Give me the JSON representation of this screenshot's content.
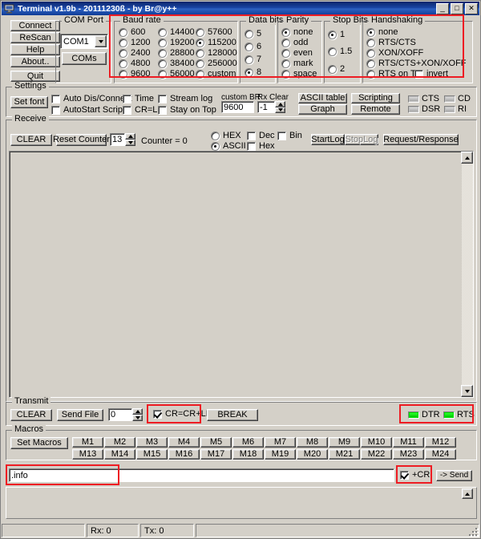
{
  "window": {
    "title": "Terminal v1.9b - 20111230ß - by Br@y++",
    "minimize": "_",
    "maximize": "□",
    "close": "✕",
    "app_icon": "terminal-icon"
  },
  "left_buttons": [
    {
      "label": "Connect",
      "name": "connect-button"
    },
    {
      "label": "ReScan",
      "name": "rescan-button"
    },
    {
      "label": "Help",
      "name": "help-button"
    },
    {
      "label": "About..",
      "name": "about-button"
    },
    {
      "label": "Quit",
      "name": "quit-button"
    }
  ],
  "com_port": {
    "legend": "COM Port",
    "selected": "COM1",
    "coms_label": "COMs"
  },
  "baud_rate": {
    "legend": "Baud rate",
    "selected": "115200",
    "col1": [
      "600",
      "1200",
      "2400",
      "4800",
      "9600"
    ],
    "col2": [
      "14400",
      "19200",
      "28800",
      "38400",
      "56000"
    ],
    "col3": [
      "57600",
      "115200",
      "128000",
      "256000",
      "custom"
    ]
  },
  "data_bits": {
    "legend": "Data bits",
    "selected": "8",
    "options": [
      "5",
      "6",
      "7",
      "8"
    ]
  },
  "parity": {
    "legend": "Parity",
    "selected": "none",
    "options": [
      "none",
      "odd",
      "even",
      "mark",
      "space"
    ]
  },
  "stop_bits": {
    "legend": "Stop Bits",
    "selected": "1",
    "options": [
      "1",
      "1.5",
      "2"
    ]
  },
  "handshaking": {
    "legend": "Handshaking",
    "selected": "none",
    "options": [
      "none",
      "RTS/CTS",
      "XON/XOFF",
      "RTS/CTS+XON/XOFF",
      "RTS on TX"
    ],
    "invert_label": "invert",
    "invert_checked": false
  },
  "settings": {
    "legend": "Settings",
    "set_font_label": "Set font",
    "checkboxes": [
      {
        "label": "Auto Dis/Connect",
        "checked": false,
        "name": "auto-disconnect-checkbox"
      },
      {
        "label": "AutoStart Script",
        "checked": false,
        "name": "autostart-script-checkbox"
      },
      {
        "label": "Time",
        "checked": false,
        "name": "time-checkbox"
      },
      {
        "label": "CR=LF",
        "checked": false,
        "name": "cr-equals-lf-checkbox"
      },
      {
        "label": "Stream log",
        "checked": false,
        "name": "stream-log-checkbox"
      },
      {
        "label": "Stay on Top",
        "checked": false,
        "name": "stay-on-top-checkbox"
      }
    ],
    "custom_br_label": "custom BR",
    "custom_br_value": "9600",
    "rx_clear_label": "Rx Clear",
    "rx_clear_value": "-1",
    "tool_buttons": [
      {
        "label": "ASCII table",
        "name": "ascii-table-button"
      },
      {
        "label": "Scripting",
        "name": "scripting-button"
      },
      {
        "label": "Graph",
        "name": "graph-button"
      },
      {
        "label": "Remote",
        "name": "remote-button"
      }
    ],
    "leds": [
      {
        "label": "CTS",
        "state": "dark"
      },
      {
        "label": "CD",
        "state": "dark"
      },
      {
        "label": "DSR",
        "state": "dark"
      },
      {
        "label": "RI",
        "state": "dark"
      }
    ]
  },
  "receive": {
    "legend": "Receive",
    "clear_label": "CLEAR",
    "reset_counter_label": "Reset Counter",
    "counter_input_value": "13",
    "counter_text": "Counter = 0",
    "format_options": [
      "HEX",
      "ASCII"
    ],
    "format_selected": "ASCII",
    "dec_label": "Dec",
    "dec_checked": false,
    "hex_label": "Hex",
    "hex_checked": false,
    "bin_label": "Bin",
    "bin_checked": false,
    "startlog_label": "StartLog",
    "stoplog_label": "StopLog",
    "stoplog_disabled": true,
    "request_response_label": "Request/Response",
    "text": ""
  },
  "transmit": {
    "legend": "Transmit",
    "clear_label": "CLEAR",
    "send_file_label": "Send File",
    "delay_value": "0",
    "cr_crlf_label": "CR=CR+LF",
    "cr_crlf_checked": true,
    "break_label": "BREAK",
    "dtr_label": "DTR",
    "dtr_on": true,
    "rts_label": "RTS",
    "rts_on": true
  },
  "macros": {
    "legend": "Macros",
    "set_macros_label": "Set Macros",
    "row1": [
      "M1",
      "M2",
      "M3",
      "M4",
      "M5",
      "M6",
      "M7",
      "M8",
      "M9",
      "M10",
      "M11",
      "M12"
    ],
    "row2": [
      "M13",
      "M14",
      "M15",
      "M16",
      "M17",
      "M18",
      "M19",
      "M20",
      "M21",
      "M22",
      "M23",
      "M24"
    ]
  },
  "send_row": {
    "input_value": ".info",
    "plus_cr_label": "+CR",
    "plus_cr_checked": true,
    "send_label": "-> Send"
  },
  "status_bar": {
    "connection": "",
    "rx": "Rx: 0",
    "tx": "Tx: 0",
    "extra": ""
  },
  "colors": {
    "highlight": "#ee1c23",
    "face": "#d4d0c8",
    "title_start": "#0a246a",
    "led_on": "#00e000"
  }
}
